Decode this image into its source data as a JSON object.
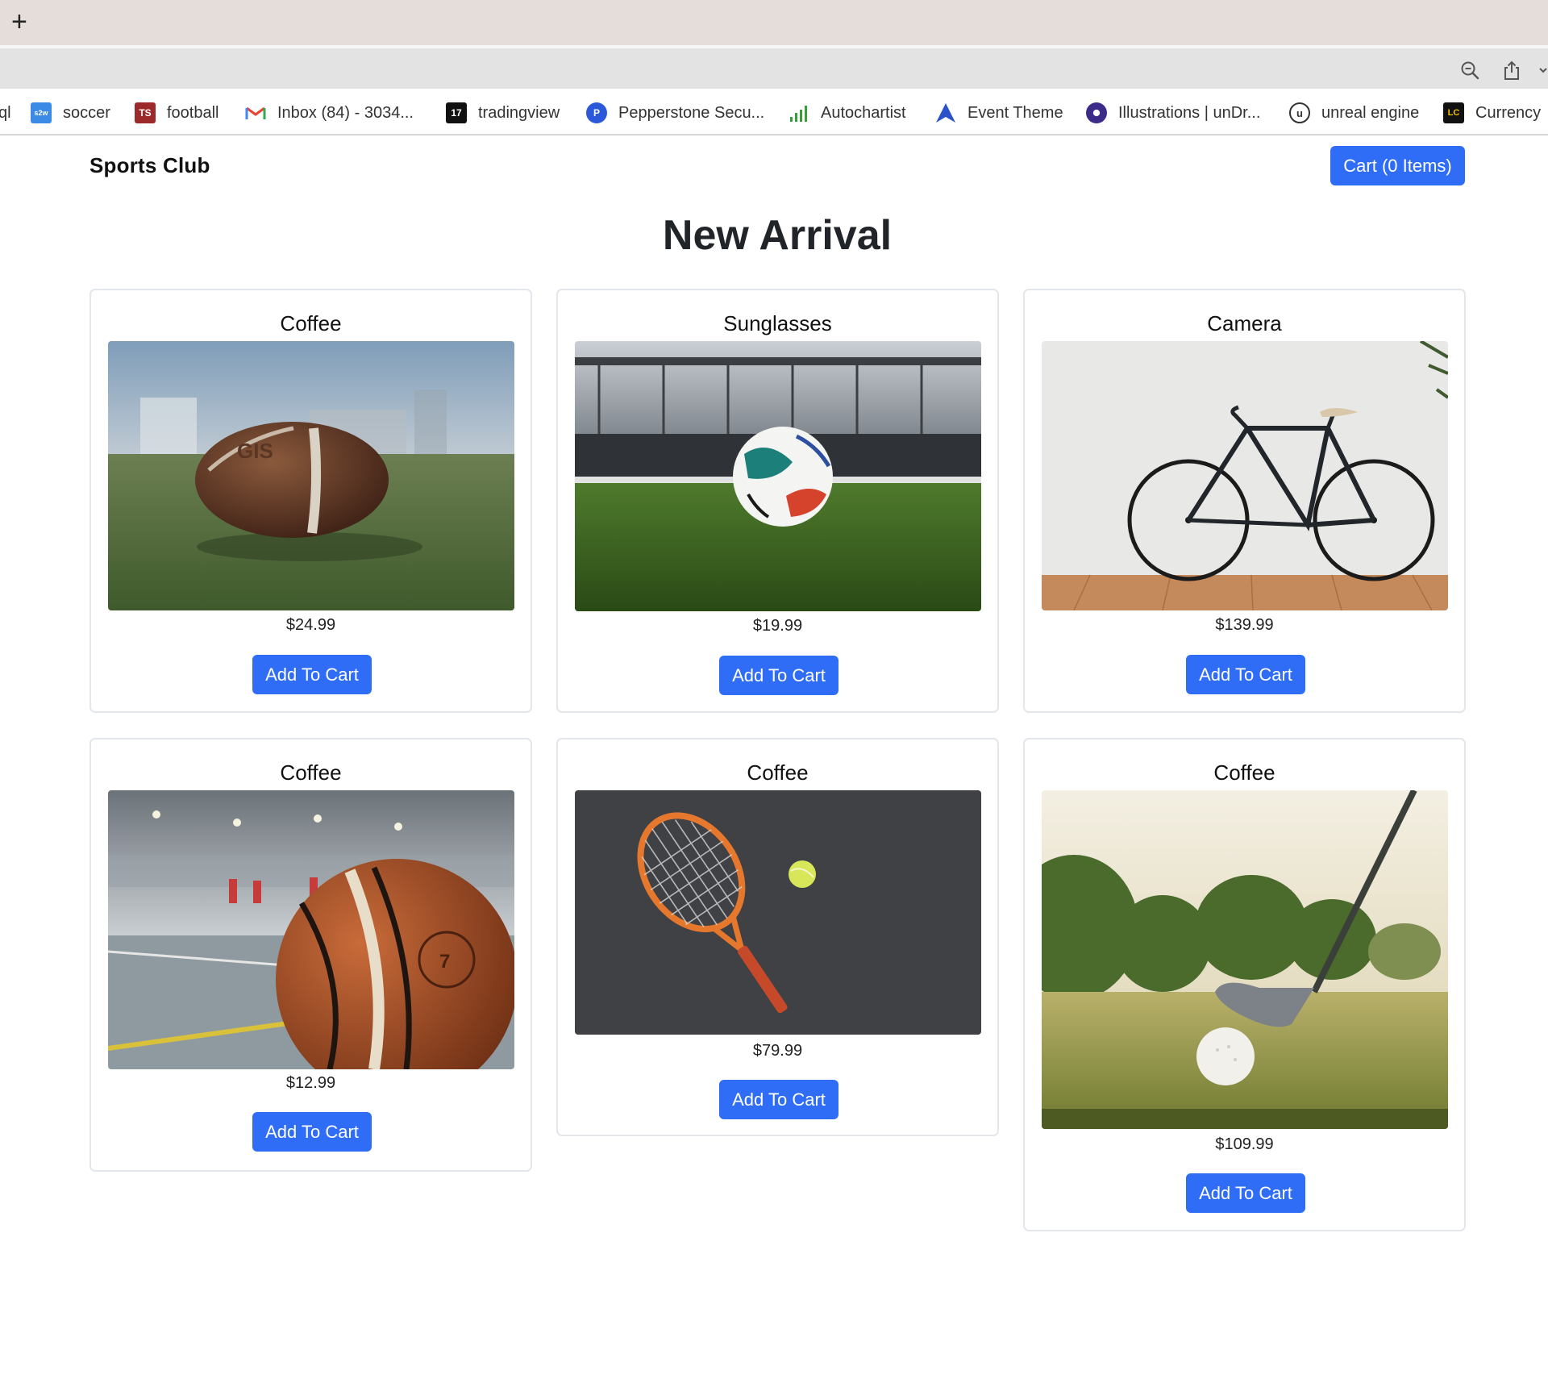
{
  "browser": {
    "new_tab_label": "+",
    "bookmarks": [
      {
        "label": "ql",
        "icon": "bookmark-fragment-icon"
      },
      {
        "label": "soccer",
        "icon": "s2w-icon",
        "color": "#3b8be6"
      },
      {
        "label": "football",
        "icon": "ts-icon",
        "color": "#9d2a2a"
      },
      {
        "label": "Inbox (84) - 3034...",
        "icon": "gmail-icon"
      },
      {
        "label": "tradingview",
        "icon": "tradingview-icon",
        "color": "#111111"
      },
      {
        "label": "Pepperstone Secu...",
        "icon": "pepperstone-icon",
        "color": "#2b59d9"
      },
      {
        "label": "Autochartist",
        "icon": "autochartist-icon"
      },
      {
        "label": "Event Theme",
        "icon": "event-theme-icon",
        "color": "#2a52c9"
      },
      {
        "label": "Illustrations | unDr...",
        "icon": "undraw-icon"
      },
      {
        "label": "unreal engine",
        "icon": "unreal-icon"
      },
      {
        "label": "Currency",
        "icon": "lc-icon"
      }
    ]
  },
  "header": {
    "brand": "Sports Club",
    "cart_label": "Cart (0 Items)"
  },
  "main": {
    "title": "New Arrival",
    "add_label": "Add To Cart",
    "products": [
      {
        "name": "Coffee",
        "price": "$24.99",
        "image": "american-football-image"
      },
      {
        "name": "Sunglasses",
        "price": "$19.99",
        "image": "soccer-ball-image"
      },
      {
        "name": "Camera",
        "price": "$139.99",
        "image": "bicycle-image"
      },
      {
        "name": "Coffee",
        "price": "$12.99",
        "image": "basketball-image"
      },
      {
        "name": "Coffee",
        "price": "$79.99",
        "image": "tennis-racket-image"
      },
      {
        "name": "Coffee",
        "price": "$109.99",
        "image": "golf-club-image"
      }
    ]
  },
  "colors": {
    "accent": "#2f6df6",
    "tabstrip": "#e5ddda",
    "toolbar": "#e3e3e3"
  }
}
